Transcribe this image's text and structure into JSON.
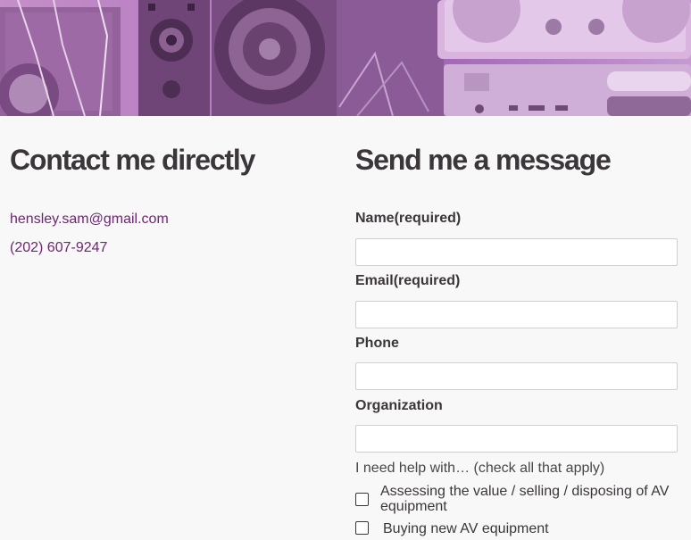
{
  "hero": {
    "image_alt": "Purple-tinted photo of stereo speakers, radio and NAD audio equipment",
    "tint_color": "#a86bb9"
  },
  "contact": {
    "heading": "Contact me directly",
    "email": "hensley.sam@gmail.com",
    "phone": "(202) 607-9247",
    "link_color": "#6e2673"
  },
  "form": {
    "heading": "Send me a message",
    "fields": [
      {
        "label": "Name(required)",
        "value": ""
      },
      {
        "label": "Email(required)",
        "value": ""
      },
      {
        "label": "Phone",
        "value": ""
      },
      {
        "label": "Organization",
        "value": ""
      }
    ],
    "help_prompt": "I need help with… (check all that apply)",
    "options": [
      {
        "label": "Assessing the value / selling / disposing of AV equipment",
        "checked": false
      },
      {
        "label": "Buying new AV equipment",
        "checked": false
      }
    ]
  }
}
